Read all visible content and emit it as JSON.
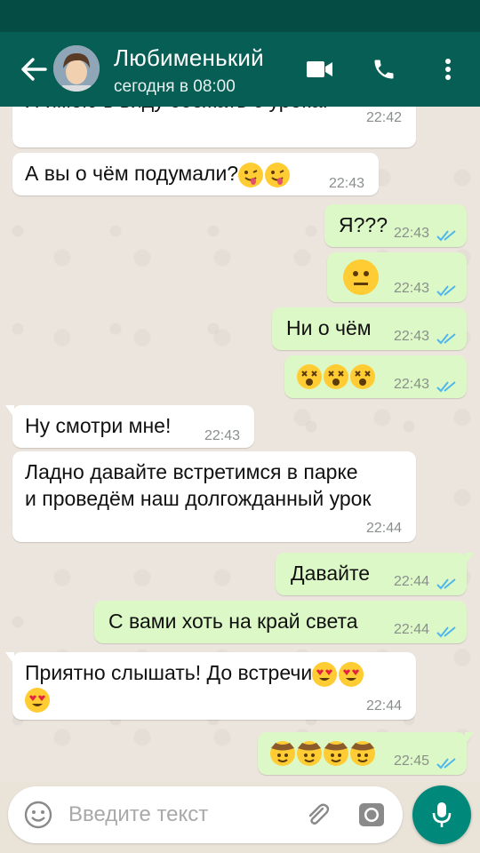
{
  "header": {
    "contact_name": "Любименький",
    "status": "сегодня в 08:00",
    "icons": [
      "back-arrow-icon",
      "video-call-icon",
      "phone-icon",
      "more-options-icon"
    ],
    "accent": "#075e54"
  },
  "messages": [
    {
      "side": "in",
      "text": "Я имею в виду сбежать с урока.",
      "time": "22:42"
    },
    {
      "side": "in",
      "text": "А вы о чём подумали?",
      "time": "22:43",
      "emoji": [
        "winking-tongue-emoji",
        "winking-tongue-emoji"
      ]
    },
    {
      "side": "out",
      "text": "Я???",
      "time": "22:43",
      "status": "read"
    },
    {
      "side": "out",
      "text": "",
      "time": "22:43",
      "status": "read",
      "emoji": [
        "neutral-face-emoji"
      ]
    },
    {
      "side": "out",
      "text": "Ни о чём",
      "time": "22:43",
      "status": "read"
    },
    {
      "side": "out",
      "text": "",
      "time": "22:43",
      "status": "read",
      "emoji": [
        "dizzy-face-emoji",
        "dizzy-face-emoji",
        "dizzy-face-emoji"
      ]
    },
    {
      "side": "in",
      "text": "Ну смотри мне!",
      "time": "22:43"
    },
    {
      "side": "in",
      "text": "Ладно давайте встретимся в парке",
      "text2": "и проведём наш долгожданный урок",
      "time": "22:44"
    },
    {
      "side": "out",
      "text": "Давайте",
      "time": "22:44",
      "status": "read"
    },
    {
      "side": "out",
      "text": "С вами хоть на край света",
      "time": "22:44",
      "status": "read"
    },
    {
      "side": "in",
      "text": "Приятно слышать! До встречи",
      "time": "22:44",
      "emoji": [
        "heart-eyes-emoji",
        "heart-eyes-emoji",
        "heart-eyes-emoji"
      ]
    },
    {
      "side": "out",
      "text": "",
      "time": "22:45",
      "status": "read",
      "emoji": [
        "cowboy-emoji",
        "cowboy-emoji",
        "cowboy-emoji",
        "cowboy-emoji"
      ]
    }
  ],
  "composer": {
    "placeholder": "Введите текст",
    "icons": [
      "emoji-icon",
      "attach-icon",
      "camera-icon",
      "mic-icon"
    ]
  },
  "colors": {
    "incoming": "#ffffff",
    "outgoing": "#dcf8c6",
    "read_ticks": "#4fb6ec"
  }
}
